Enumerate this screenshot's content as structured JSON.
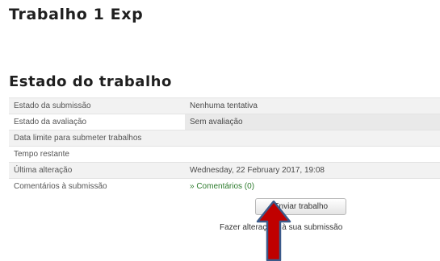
{
  "page": {
    "title": "Trabalho 1 Exp"
  },
  "status_section": {
    "title": "Estado do trabalho",
    "rows": [
      {
        "label": "Estado da submissão",
        "value": "Nenhuma tentativa"
      },
      {
        "label": "Estado da avaliação",
        "value": "Sem avaliação"
      },
      {
        "label": "Data limite para submeter trabalhos",
        "value": ""
      },
      {
        "label": "Tempo restante",
        "value": ""
      },
      {
        "label": "Última alteração",
        "value": "Wednesday, 22 February 2017, 19:08"
      },
      {
        "label": "Comentários à submissão",
        "value": "» Comentários (0)"
      }
    ]
  },
  "actions": {
    "submit_label": "Enviar trabalho",
    "help_text": "Fazer alterações à sua submissão"
  },
  "annotation": {
    "arrow_color": "#c00000",
    "arrow_outline_color": "#3b5a8a"
  }
}
